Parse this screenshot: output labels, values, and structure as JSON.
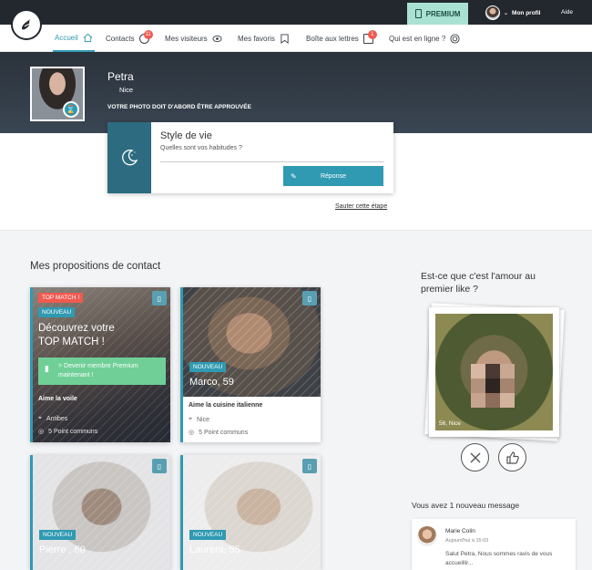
{
  "topbar": {
    "premium_label": "PREMIUM",
    "profile_label": "Mon profil",
    "help_label": "Aide"
  },
  "nav": {
    "items": [
      {
        "label": "Accueil",
        "icon": "home-icon",
        "active": true
      },
      {
        "label": "Contacts",
        "icon": "contacts-icon",
        "badge": "11"
      },
      {
        "label": "Mes visiteurs",
        "icon": "eye-icon"
      },
      {
        "label": "Mes favoris",
        "icon": "bookmark-icon"
      },
      {
        "label": "Boîte aux lettres",
        "icon": "mail-icon",
        "badge": "1"
      },
      {
        "label": "Qui est en ligne ?",
        "icon": "radar-icon"
      }
    ]
  },
  "profile": {
    "name": "Petra",
    "city": "Nice",
    "photo_notice": "VOTRE PHOTO DOIT D'ABORD ÊTRE APPROUVÉE"
  },
  "lifestyle": {
    "title": "Style de vie",
    "question": "Quelles sont vos habitudes ?",
    "reply_label": "Réponse",
    "skip_label": "Sauter cette étape"
  },
  "proposals": {
    "title": "Mes propositions de contact",
    "top_match": {
      "tag": "TOP MATCH !",
      "new_tag": "NOUVEAU",
      "headline_1": "Découvrez votre",
      "headline_2": "TOP MATCH !",
      "premium_cta": "> Devenir membre Premium maintenant !",
      "hobby": "Aime la voile",
      "city": "Antibes",
      "common": "5 Point communs"
    },
    "cards": [
      {
        "tag": "NOUVEAU",
        "name": "Marco, 59",
        "hobby": "Aime la cuisine italienne",
        "city": "Nice",
        "common": "5 Point communs"
      },
      {
        "tag": "NOUVEAU",
        "name": "Pierre , 60"
      },
      {
        "tag": "NOUVEAU",
        "name": "Laurent, 55"
      }
    ]
  },
  "like_game": {
    "title": "Est-ce que c'est l'amour au premier like ?",
    "caption": "56, Nice"
  },
  "messages": {
    "title": "Vous avez 1 nouveau message",
    "sender": "Marie Colin",
    "date": "Aujourd'hui à 15:03",
    "text": "Salut Petra, Nous sommes ravis de vous accueillir..."
  },
  "colors": {
    "accent": "#2f9ab2",
    "dark": "#23282f",
    "premium": "#a9e1d2",
    "badge": "#f05a4f",
    "cta_green": "#6fcf97"
  }
}
